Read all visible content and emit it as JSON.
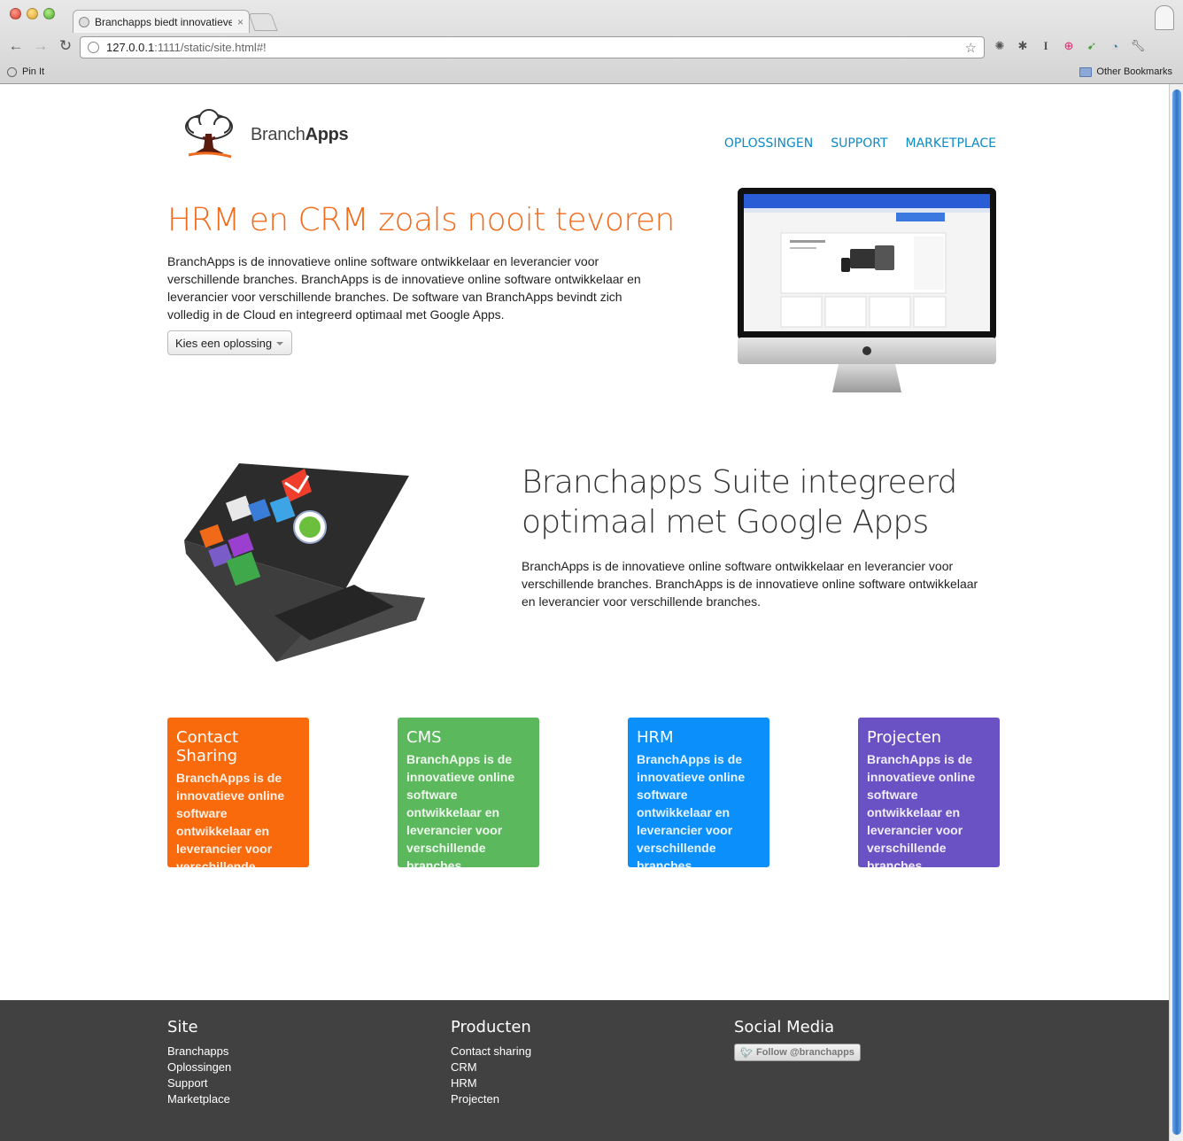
{
  "browser": {
    "tab_title": "Branchapps biedt innovatieve",
    "tab_close": "×",
    "url_host": "127.0.0.1",
    "url_path": ":1111/static/site.html#!",
    "bookmarks": {
      "pin_label": "Pin It",
      "other_label": "Other Bookmarks"
    }
  },
  "header": {
    "logo_regular": "Branch",
    "logo_bold": "Apps",
    "nav": [
      "OPLOSSINGEN",
      "SUPPORT",
      "MARKETPLACE"
    ]
  },
  "hero": {
    "title": "HRM en CRM zoals nooit tevoren",
    "text": "BranchApps is de innovatieve online software ontwikkelaar en leverancier voor verschillende branches. BranchApps is de innovatieve online software ontwikkelaar en leverancier voor verschillende branches. De software van BranchApps bevindt zich volledig in de Cloud en integreerd optimaal met Google Apps.",
    "dropdown_label": "Kies een oplossing"
  },
  "suite": {
    "title": "Branchapps Suite integreerd optimaal met Google Apps",
    "text": "BranchApps is de innovatieve online software ontwikkelaar en leverancier voor verschillende branches. BranchApps is de innovatieve online software ontwikkelaar en leverancier voor verschillende branches."
  },
  "cards": [
    {
      "title": "Contact Sharing",
      "text": "BranchApps is de innovatieve online software ontwikkelaar en leverancier voor verschillende branches.",
      "color": "#f86a0c"
    },
    {
      "title": "CMS",
      "text": "BranchApps is de innovatieve online software ontwikkelaar en leverancier voor verschillende branches.",
      "color": "#5cb85c"
    },
    {
      "title": "HRM",
      "text": "BranchApps is de innovatieve online software ontwikkelaar en leverancier voor verschillende branches.",
      "color": "#0a8ffb"
    },
    {
      "title": "Projecten",
      "text": "BranchApps is de innovatieve online software ontwikkelaar en leverancier voor verschillende branches.",
      "color": "#6a51c4"
    }
  ],
  "footer": {
    "site": {
      "heading": "Site",
      "links": [
        "Branchapps",
        "Oplossingen",
        "Support",
        "Marketplace"
      ]
    },
    "producten": {
      "heading": "Producten",
      "links": [
        "Contact sharing",
        "CRM",
        "HRM",
        "Projecten"
      ]
    },
    "social": {
      "heading": "Social Media",
      "follow_label": "Follow @branchapps"
    }
  },
  "colors": {
    "accent_orange": "#f26b1d",
    "nav_blue": "#0b8bc5",
    "footer_bg": "#414141"
  }
}
